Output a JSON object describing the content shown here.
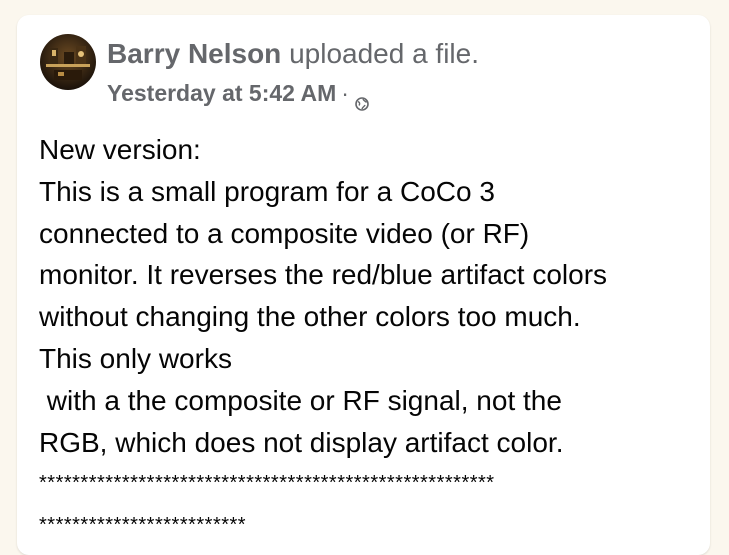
{
  "post": {
    "author": "Barry Nelson",
    "action": " uploaded a file.",
    "timestamp": "Yesterday at 5:42 AM",
    "separator": "·",
    "visibility_icon": "globe-icon",
    "lines": [
      "New version:",
      "This is a small program for a CoCo 3",
      "connected to a composite video (or RF)",
      "monitor. It reverses the red/blue artifact colors",
      "without changing the other colors too much.",
      "This only works",
      " with a the composite or RF signal, not the",
      "RGB, which does not display artifact color.",
      "*******************************************************",
      "*************************"
    ]
  },
  "colors": {
    "background": "#fbf7ee",
    "card": "#ffffff",
    "secondary_text": "#65676b",
    "primary_text": "#050505"
  }
}
